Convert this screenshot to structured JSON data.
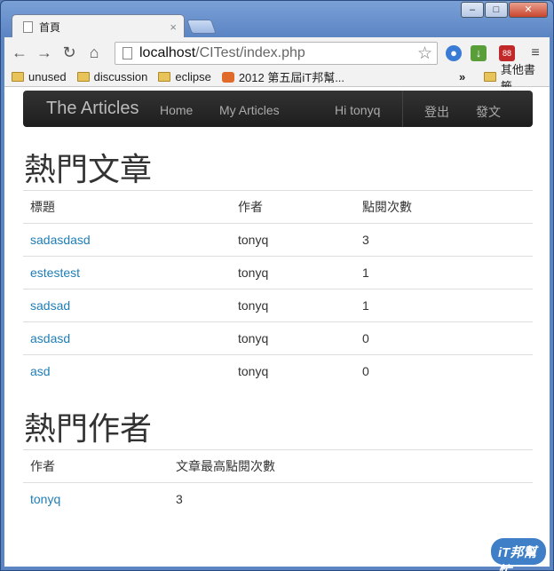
{
  "browser": {
    "tab_title": "首頁",
    "url_host": "localhost",
    "url_path": "/CITest/index.php",
    "window_controls": [
      "–",
      "□",
      "✕"
    ]
  },
  "bookmarks": {
    "items": [
      "unused",
      "discussion",
      "eclipse",
      "2012 第五屆iT邦幫..."
    ],
    "other": "其他書籤"
  },
  "navbar": {
    "brand": "The Articles",
    "links": [
      "Home",
      "My Articles"
    ],
    "greeting": "Hi tonyq",
    "logout": "登出",
    "post": "發文"
  },
  "hot_articles": {
    "title": "熱門文章",
    "headers": [
      "標題",
      "作者",
      "點閱次數"
    ],
    "rows": [
      {
        "title": "sadasdasd",
        "author": "tonyq",
        "views": "3"
      },
      {
        "title": "estestest",
        "author": "tonyq",
        "views": "1"
      },
      {
        "title": "sadsad",
        "author": "tonyq",
        "views": "1"
      },
      {
        "title": "asdasd",
        "author": "tonyq",
        "views": "0"
      },
      {
        "title": "asd",
        "author": "tonyq",
        "views": "0"
      }
    ]
  },
  "hot_authors": {
    "title": "熱門作者",
    "headers": [
      "作者",
      "文章最高點閱次數"
    ],
    "rows": [
      {
        "author": "tonyq",
        "max_views": "3"
      }
    ]
  },
  "watermark": "iT邦幫忙"
}
